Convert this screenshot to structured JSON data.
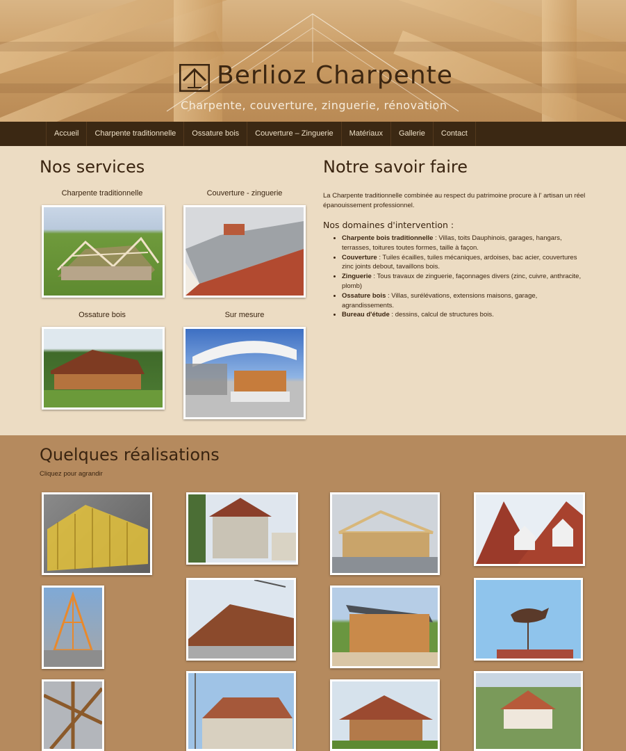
{
  "header": {
    "title": "Berlioz Charpente",
    "subtitle": "Charpente, couverture, zinguerie, rénovation"
  },
  "nav": {
    "items": [
      "Accueil",
      "Charpente traditionnelle",
      "Ossature bois",
      "Couverture – Zinguerie",
      "Matériaux",
      "Gallerie",
      "Contact"
    ]
  },
  "services": {
    "title": "Nos services",
    "items": [
      {
        "label": "Charpente traditionnelle",
        "image": "charpente-traditionnelle-photo"
      },
      {
        "label": "Couverture - zinguerie",
        "image": "couverture-zinguerie-photo"
      },
      {
        "label": "Ossature bois",
        "image": "ossature-bois-photo"
      },
      {
        "label": "Sur mesure",
        "image": "sur-mesure-photo"
      }
    ]
  },
  "savoir_faire": {
    "title": "Notre savoir faire",
    "intro": "La Charpente traditionnelle combinée au respect du patrimoine procure à l' artisan un réel épanouissement professionnel.",
    "domains_title": "Nos domaines d'intervention :",
    "domains": [
      {
        "name": "Charpente bois traditionnelle",
        "text": " : Villas, toits Dauphinois, garages, hangars, terrasses, toitures toutes formes, taille à façon."
      },
      {
        "name": "Couverture",
        "text": " : Tuiles écailles, tuiles mécaniques, ardoises, bac acier, couvertures zinc joints debout, tavaillons bois."
      },
      {
        "name": "Zinguerie",
        "text": " : Tous travaux de zinguerie, façonnages divers (zinc, cuivre, anthracite, plomb)"
      },
      {
        "name": "Ossature bois",
        "text": " : Villas, surélévations, extensions maisons, garage, agrandissements."
      },
      {
        "name": "Bureau d'étude",
        "text": " : dessins, calcul de structures bois."
      }
    ]
  },
  "realisations": {
    "title": "Quelques réalisations",
    "subtitle": "Cliquez pour agrandir"
  },
  "colors": {
    "nav_bg": "#3b2813",
    "services_bg": "#ecdcc3",
    "realisations_bg": "#b58a5e",
    "text": "#3a2410"
  }
}
